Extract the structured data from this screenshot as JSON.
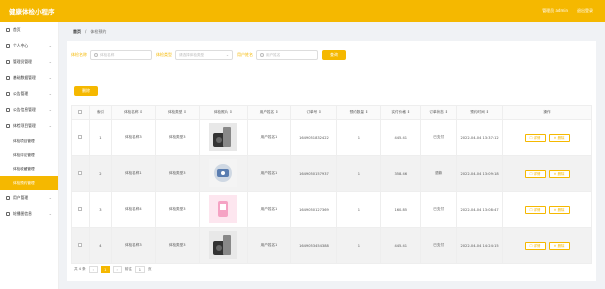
{
  "app": {
    "title": "健康体检小程序"
  },
  "header": {
    "admin_label": "管理员 admin",
    "logout": "退出登录"
  },
  "sidebar": {
    "items": [
      {
        "label": "首页",
        "chev": ""
      },
      {
        "label": "个人中心",
        "chev": "⌄"
      },
      {
        "label": "管理员管理",
        "chev": "⌄"
      },
      {
        "label": "基础数据管理",
        "chev": "⌄"
      },
      {
        "label": "公告管理",
        "chev": "⌄"
      },
      {
        "label": "公告信息管理",
        "chev": "⌄"
      },
      {
        "label": "体检项目管理",
        "chev": "⌄"
      }
    ],
    "subitems": [
      {
        "label": "体检项目管理"
      },
      {
        "label": "体检评论管理"
      },
      {
        "label": "体检收藏管理"
      },
      {
        "label": "体检预约管理"
      }
    ],
    "more": [
      {
        "label": "用户管理",
        "chev": "⌄"
      },
      {
        "label": "轮播图信息",
        "chev": "⌄"
      }
    ]
  },
  "breadcrumb": {
    "home": "首页",
    "sep": "/",
    "current": "体检预约"
  },
  "filters": {
    "f1_label": "体检名称",
    "f1_placeholder": "体检名称",
    "f2_label": "体检类型",
    "f2_placeholder": "请选择体检类型",
    "f3_label": "用户姓名",
    "f3_placeholder": "用户姓名",
    "search": "查询"
  },
  "toolbar": {
    "delete": "删除"
  },
  "table": {
    "headers": [
      "",
      "索引",
      "体检名称 ⇕",
      "体检类型 ⇕",
      "体检照片 ⇕",
      "用户姓名 ⇕",
      "订单号 ⇕",
      "预约数量 ⇕",
      "实付价格 ⇕",
      "订单状态 ⇕",
      "预约时间 ⇕",
      "操作"
    ],
    "rows": [
      {
        "index": "1",
        "name": "体检名称3",
        "type": "体检类型3",
        "img": "camera",
        "user": "用户姓名1",
        "order": "1649051832422",
        "qty": "1",
        "price": "445.41",
        "status": "已支付",
        "time": "2022-04-04 13:37:12"
      },
      {
        "index": "2",
        "name": "体检名称1",
        "type": "体检类型3",
        "img": "device",
        "user": "用户姓名1",
        "order": "1649050157937",
        "qty": "1",
        "price": "358.46",
        "status": "退款",
        "time": "2022-04-04 13:09:18"
      },
      {
        "index": "3",
        "name": "体检名称4",
        "type": "体检类型3",
        "img": "pink",
        "user": "用户姓名1",
        "order": "1649050127369",
        "qty": "1",
        "price": "160.85",
        "status": "已支付",
        "time": "2022-04-04 13:08:47"
      },
      {
        "index": "4",
        "name": "体检名称3",
        "type": "体检类型3",
        "img": "camera",
        "user": "用户姓名1",
        "order": "1649053454388",
        "qty": "1",
        "price": "445.41",
        "status": "已支付",
        "time": "2022-04-04 14:24:15"
      }
    ],
    "op_detail": "详情",
    "op_delete": "删除"
  },
  "pager": {
    "total": "共 4 条",
    "prev": "‹",
    "page": "1",
    "next": "›",
    "goto": "前往",
    "goto_val": "1",
    "page_unit": "页"
  },
  "colors": {
    "accent": "#f5b800"
  }
}
